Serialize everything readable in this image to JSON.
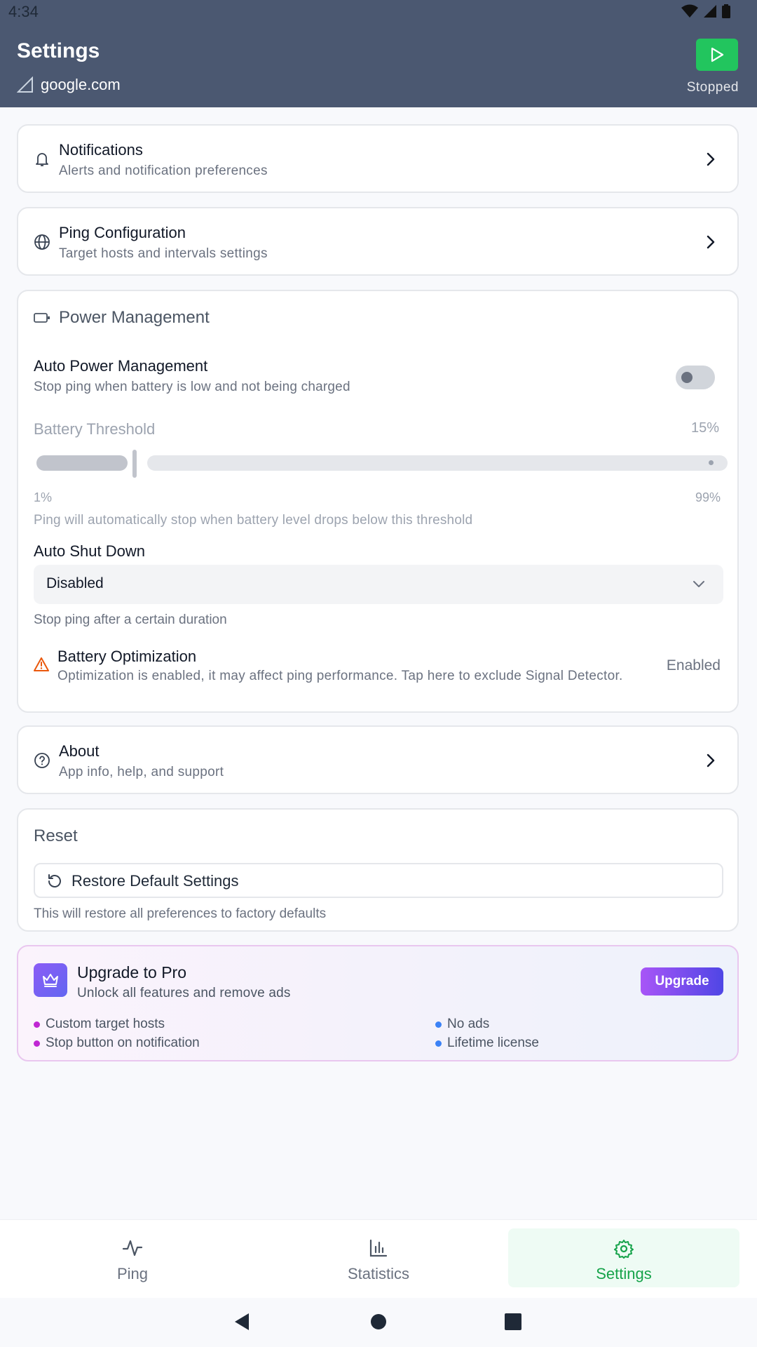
{
  "status_bar": {
    "time": "4:34"
  },
  "header": {
    "title": "Settings",
    "host": "google.com",
    "state": "Stopped"
  },
  "notifications": {
    "title": "Notifications",
    "subtitle": "Alerts and notification preferences"
  },
  "ping_config": {
    "title": "Ping Configuration",
    "subtitle": "Target hosts and intervals settings"
  },
  "power": {
    "title": "Power Management",
    "auto_power": {
      "title": "Auto Power Management",
      "subtitle": "Stop ping when battery is low and not being charged",
      "enabled": false
    },
    "battery_threshold": {
      "label": "Battery Threshold",
      "value": "15%",
      "min": "1%",
      "max": "99%",
      "note": "Ping will automatically stop when battery level drops below this threshold"
    },
    "auto_shutdown": {
      "label": "Auto Shut Down",
      "selected": "Disabled",
      "note": "Stop ping after a certain duration"
    },
    "battery_opt": {
      "title": "Battery Optimization",
      "subtitle": "Optimization is enabled, it may affect ping performance. Tap here to exclude Signal Detector.",
      "status": "Enabled"
    }
  },
  "about": {
    "title": "About",
    "subtitle": "App info, help, and support"
  },
  "reset": {
    "title": "Reset",
    "button": "Restore Default Settings",
    "note": "This will restore all preferences to factory defaults"
  },
  "pro": {
    "title": "Upgrade to Pro",
    "subtitle": "Unlock all features and remove ads",
    "button": "Upgrade",
    "features": [
      "Custom target hosts",
      "Stop button on notification",
      "No ads",
      "Lifetime license"
    ]
  },
  "nav": {
    "items": [
      "Ping",
      "Statistics",
      "Settings"
    ],
    "active": "Settings"
  },
  "colors": {
    "header": "#4b5871",
    "accent_green": "#22c55e",
    "active_nav": "#16a34a"
  }
}
